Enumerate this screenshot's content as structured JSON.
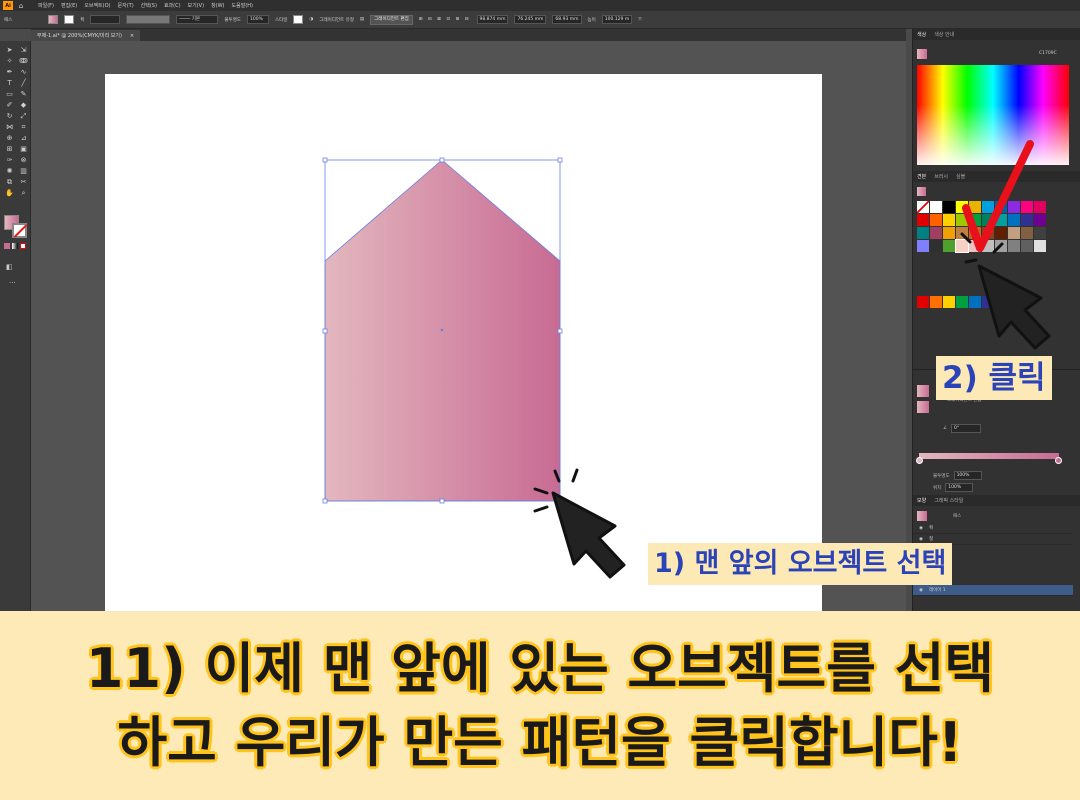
{
  "app": {
    "logo": "Ai"
  },
  "menu": {
    "items": [
      "파일(F)",
      "편집(E)",
      "오브젝트(O)",
      "문자(T)",
      "선택(S)",
      "효과(C)",
      "보기(V)",
      "창(W)",
      "도움말(H)"
    ]
  },
  "control": {
    "selection_label": "패스",
    "stroke_weight_label": "획",
    "brush_label": "기본",
    "opacity_label": "불투명도",
    "opacity_value": "100%",
    "style_label": "스타일",
    "gradient_type_label": "그레이디언트 유형",
    "gradient_edit_button": "그레이디언트 편집",
    "x_value": "98.874 mm",
    "y_value": "76.245 mm",
    "w_value": "68.93 mm",
    "height_label": "높이",
    "h_value": "100.129 m"
  },
  "document": {
    "tab_title": "무제-1.ai* @ 200%(CMYK/미리 보기)",
    "close_icon": "×"
  },
  "panels": {
    "color_tabs": [
      "색상",
      "색상 안내"
    ],
    "hex_value": "C1709C",
    "swatch_tabs": [
      "견본",
      "브러시",
      "심볼"
    ],
    "gradient_opacity_label": "불투명도",
    "gradient_opacity_value": "100%",
    "gradient_location_label": "위치",
    "gradient_location_value": "100%",
    "gradient_angle_value": "0°",
    "gradient_edit_label": "그레이디언트 편집",
    "layer_tabs": [
      "모양",
      "그래픽 스타일"
    ],
    "appearance_title": "패스",
    "appearance_rows": [
      "획",
      "칠"
    ],
    "layer_name": "레이어 1"
  },
  "swatch_colors": [
    "#ffffff",
    "#ffffff",
    "#000000",
    "#ffff00",
    "#e8b400",
    "#00a0e0",
    "#0060b0",
    "#8a2be2",
    "#ff0080",
    "#e00060",
    "#e00000",
    "#ff6000",
    "#ffd000",
    "#a0c800",
    "#00a040",
    "#008060",
    "#00a0a0",
    "#0070c0",
    "#303090",
    "#700090",
    "#008080",
    "#a04060",
    "#f0a000",
    "#c08040",
    "#d06020",
    "#904020",
    "#602000",
    "#c0a080",
    "#806040",
    "#404040",
    "#8080ff",
    "#303030",
    "#50a030",
    "#6b8040",
    "#f0c0c0",
    "#c0c0c0",
    "#a0a0a0",
    "#808080",
    "#606060",
    "#e0e0e0"
  ],
  "bottom_swatch_colors": [
    "#e00000",
    "#ff7000",
    "#ffd000",
    "#00a040",
    "#0070c0",
    "#303090",
    "#8a2be2"
  ],
  "annotations": {
    "step1": "1) 맨 앞의 오브젝트 선택",
    "step2": "2) 클릭"
  },
  "caption": {
    "line1": "11) 이제 맨 앞에 있는 오브젝트를 선택",
    "line2": "하고 우리가 만든 패턴을 클릭합니다!"
  },
  "colors": {
    "gradient_start": "#e3b7bf",
    "gradient_end": "#c86b93",
    "selection_blue": "#6a7fe0",
    "annotation_text": "#2b43b8",
    "annotation_bg": "#fde9b5",
    "caption_outline": "#ffc31a",
    "check_red": "#e8101a"
  }
}
